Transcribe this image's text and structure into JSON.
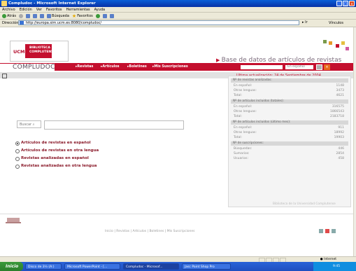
{
  "window": {
    "title": "Compludoc - Microsoft Internet Explorer",
    "buttons": [
      "_",
      "□",
      "x"
    ]
  },
  "menubar": {
    "items": [
      "Archivo",
      "Edición",
      "Ver",
      "Favoritos",
      "Herramientas",
      "Ayuda"
    ]
  },
  "toolbar": {
    "back": "Atrás",
    "search": "Búsqueda",
    "favorites": "Favoritos"
  },
  "addressbar": {
    "label": "Dirección",
    "url": "http://europa.sim.ucm.es:8080/compludoc/",
    "go": "Ir",
    "links": "Vínculos"
  },
  "header": {
    "ucm": "UCM",
    "library": "BIBLIOTECA COMPLUTENSE",
    "site_title": "Base de datos de artículos de revistas",
    "brand": "COMPLUDOC",
    "nav": [
      "Revistas",
      "Artículos",
      "Boletines",
      "Mis Suscripciones"
    ],
    "language": "En español",
    "update": "Ultima actualización: 24 de Septiembre de 2004"
  },
  "search": {
    "button": "Buscar",
    "options": [
      {
        "label": "Artículos de revistas en español",
        "selected": true
      },
      {
        "label": "Artículos de revistas en otra lengua",
        "selected": false
      },
      {
        "label": "Revistas analizadas en español",
        "selected": false
      },
      {
        "label": "Revistas analizadas en otra lengua",
        "selected": false
      }
    ]
  },
  "stats": [
    {
      "heading": "Nº de revistas analizadas:",
      "rows": [
        {
          "label": "En español:",
          "value": "1148"
        },
        {
          "label": "Otras lenguas:",
          "value": "3473"
        },
        {
          "label": "Total:",
          "value": "4621"
        }
      ]
    },
    {
      "heading": "Nº de artículos incluidos (totales):",
      "rows": [
        {
          "label": "En español:",
          "value": "316575"
        },
        {
          "label": "Otras lenguas:",
          "value": "1866543"
        },
        {
          "label": "Total:",
          "value": "2183718"
        }
      ]
    },
    {
      "heading": "Nº de artículos incluidos (último mes):",
      "rows": [
        {
          "label": "En español:",
          "value": "911"
        },
        {
          "label": "Otras lenguas:",
          "value": "18992"
        },
        {
          "label": "Total:",
          "value": "19903"
        }
      ]
    },
    {
      "heading": "Nº de suscripciones:",
      "rows": [
        {
          "label": "Búsquedas:",
          "value": "446"
        },
        {
          "label": "Sumarios:",
          "value": "2854"
        },
        {
          "label": "Usuarios:",
          "value": "458"
        }
      ]
    }
  ],
  "footer": {
    "right_link": "Biblioteca de la Universidad Complutense",
    "nav": "Inicio | Revistas | Artículos | Boletines | Mis Suscripciones"
  },
  "statusbar": {
    "zone": "Internet"
  },
  "taskbar": {
    "start": "Inicio",
    "tasks": [
      "Disco de 3½ (A:)",
      "Microsoft PowerPoint - [...",
      "Compludoc - Microsof...",
      "Jasc Paint Shop Pro"
    ],
    "clock": "9:45"
  },
  "colors": {
    "accent_red": "#c40f2e",
    "xp_blue": "#0a5fd8"
  }
}
